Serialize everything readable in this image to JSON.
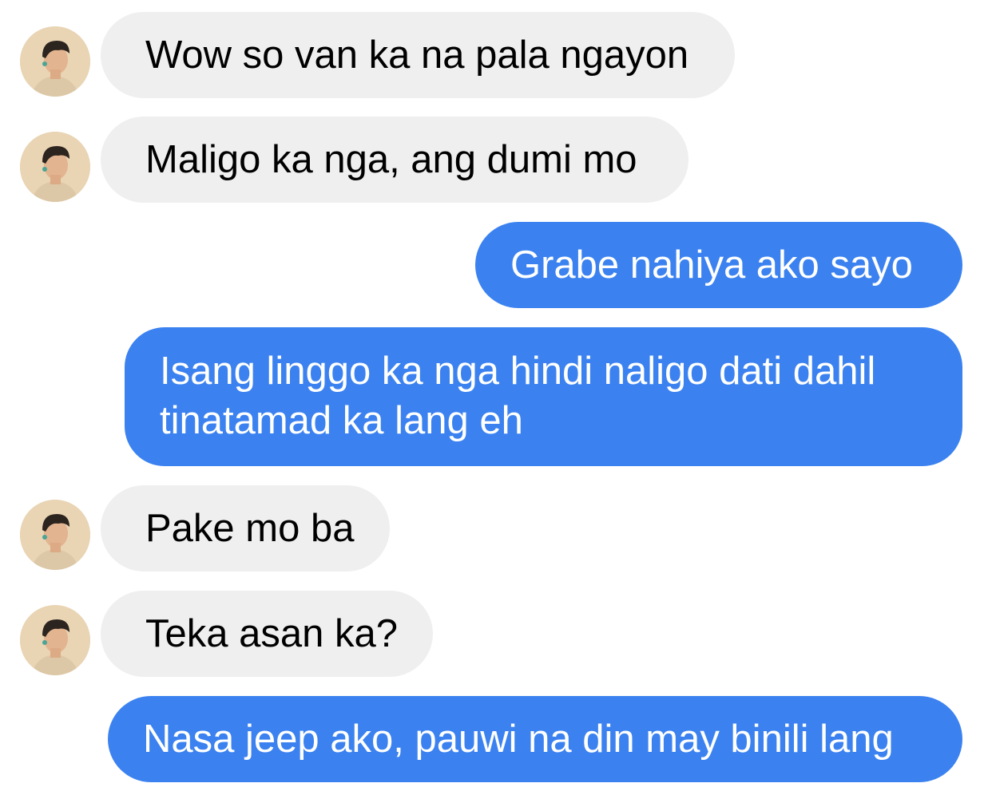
{
  "colors": {
    "incoming_bubble": "#efefef",
    "outgoing_bubble": "#3b82f0",
    "incoming_text": "#000000",
    "outgoing_text": "#ffffff"
  },
  "messages": [
    {
      "direction": "incoming",
      "text": "Wow so van ka na pala ngayon"
    },
    {
      "direction": "incoming",
      "text": "Maligo ka nga, ang dumi mo"
    },
    {
      "direction": "outgoing",
      "text": "Grabe nahiya ako sayo"
    },
    {
      "direction": "outgoing",
      "text": "Isang linggo ka nga hindi naligo dati dahil tinatamad ka lang eh"
    },
    {
      "direction": "incoming",
      "text": "Pake mo ba"
    },
    {
      "direction": "incoming",
      "text": "Teka asan ka?"
    },
    {
      "direction": "outgoing",
      "text": "Nasa jeep ako, pauwi na din may binili lang"
    }
  ]
}
